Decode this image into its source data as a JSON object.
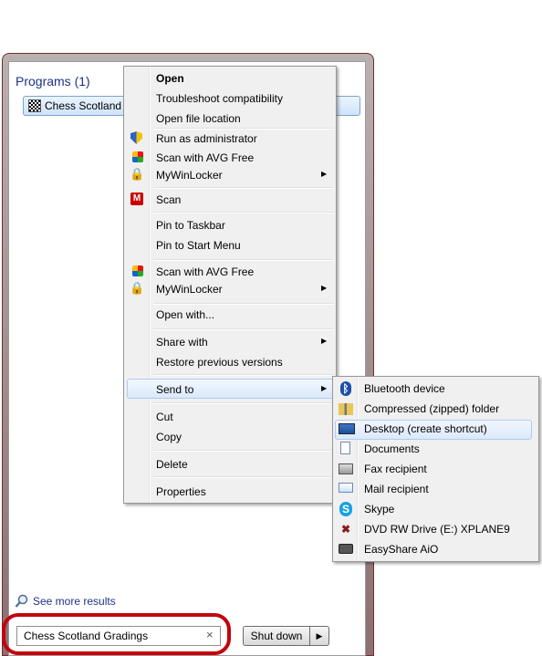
{
  "start_menu": {
    "programs_heading": "Programs (1)",
    "program_item_label": "Chess Scotland G",
    "see_more_label": "See more results",
    "search_value": "Chess Scotland Gradings",
    "search_clear_glyph": "×",
    "shutdown_label": "Shut down",
    "shutdown_arrow": "▶"
  },
  "context_menu": {
    "items": [
      {
        "label": "Open"
      },
      {
        "label": "Troubleshoot compatibility"
      },
      {
        "label": "Open file location"
      },
      {
        "label": "Run as administrator",
        "icon": "uac-shield-icon"
      },
      {
        "label": "Scan with AVG Free",
        "icon": "avg-icon"
      },
      {
        "label": "MyWinLocker",
        "icon": "mywinlocker-icon"
      },
      {
        "label": "Scan",
        "icon": "mcafee-icon"
      },
      {
        "label": "Pin to Taskbar"
      },
      {
        "label": "Pin to Start Menu"
      },
      {
        "label": "Scan with AVG Free",
        "icon": "avg-icon"
      },
      {
        "label": "MyWinLocker",
        "icon": "mywinlocker-icon"
      },
      {
        "label": "Open with..."
      },
      {
        "label": "Share with"
      },
      {
        "label": "Restore previous versions"
      },
      {
        "label": "Send to"
      },
      {
        "label": "Cut"
      },
      {
        "label": "Copy"
      },
      {
        "label": "Delete"
      },
      {
        "label": "Properties"
      }
    ],
    "submenu_arrow": "▶"
  },
  "send_to_menu": {
    "items": [
      {
        "label": "Bluetooth device",
        "icon": "bluetooth-icon"
      },
      {
        "label": "Compressed (zipped) folder",
        "icon": "zip-folder-icon"
      },
      {
        "label": "Desktop (create shortcut)",
        "icon": "desktop-icon"
      },
      {
        "label": "Documents",
        "icon": "documents-icon"
      },
      {
        "label": "Fax recipient",
        "icon": "fax-icon"
      },
      {
        "label": "Mail recipient",
        "icon": "mail-icon"
      },
      {
        "label": "Skype",
        "icon": "skype-icon"
      },
      {
        "label": "DVD RW Drive (E:) XPLANE9",
        "icon": "dvd-drive-icon"
      },
      {
        "label": "EasyShare AiO",
        "icon": "camera-icon"
      }
    ]
  },
  "colors": {
    "accent_red_ring": "#c4000f",
    "heading_blue": "#1e3287",
    "highlight_border": "#aeccf1"
  }
}
